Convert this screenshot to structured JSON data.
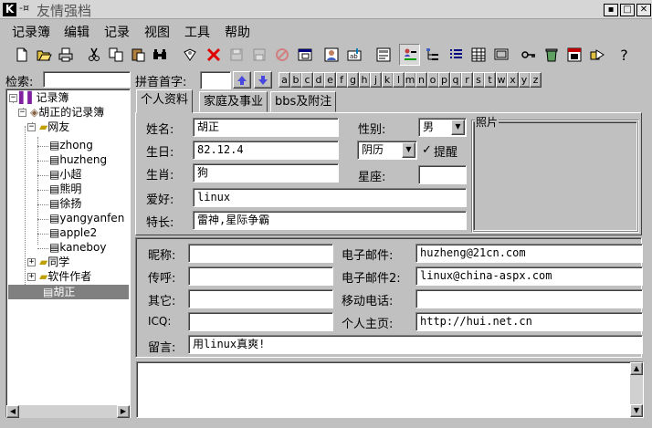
{
  "window": {
    "title": "友情强档",
    "logo_letter": "K",
    "arrow": "-¤",
    "controls": {
      "minimize": "▪",
      "maximize": "□",
      "close": "✕"
    }
  },
  "menu": [
    "记录簿",
    "编辑",
    "记录",
    "视图",
    "工具",
    "帮助"
  ],
  "toolbar": {
    "icons": [
      "new-icon",
      "open-icon",
      "print-icon",
      "cut-icon",
      "copy-icon",
      "paste-icon",
      "find-icon",
      "attach-icon",
      "delete-icon",
      "save-icon",
      "save-all-icon",
      "cancel-icon",
      "window-icon",
      "contact-card-icon",
      "edit-text-icon",
      "properties-icon",
      "contacts-view-icon",
      "tree-view-icon",
      "list-view-icon",
      "grid-view-icon",
      "layout-icon",
      "key-icon",
      "recycle-icon",
      "calendar-icon",
      "export-icon",
      "help-icon"
    ],
    "help_label": "?"
  },
  "search": {
    "label": "检索:",
    "value": ""
  },
  "tree": {
    "root": "记录簿",
    "book": "胡正的记录簿",
    "group1": "网友",
    "contacts": [
      "zhong",
      "huzheng",
      "小超",
      "熊明",
      "徐扬",
      "yangyanfen",
      "apple2",
      "kaneboy"
    ],
    "group2": "同学",
    "group3": "软件作者",
    "selected": "胡正"
  },
  "pinyin": {
    "label": "拼音首字:",
    "value": "",
    "letters": [
      "a",
      "b",
      "c",
      "d",
      "e",
      "f",
      "g",
      "h",
      "j",
      "k",
      "l",
      "m",
      "n",
      "o",
      "p",
      "q",
      "r",
      "s",
      "t",
      "w",
      "x",
      "y",
      "z"
    ]
  },
  "tabs": [
    "个人资料",
    "家庭及事业",
    "bbs及附注"
  ],
  "personal": {
    "name_label": "姓名:",
    "name": "胡正",
    "gender_label": "性别:",
    "gender": "男",
    "birthday_label": "生日:",
    "birthday": "82.12.4",
    "calendar": "阴历",
    "remind_check": "✓",
    "remind_label": "提醒",
    "zodiac_label": "生肖:",
    "zodiac": "狗",
    "star_label": "星座:",
    "star": "",
    "hobby_label": "爱好:",
    "hobby": "linux",
    "skill_label": "特长:",
    "skill": "雷神,星际争霸",
    "photo_label": "照片"
  },
  "contact": {
    "nickname_label": "昵称:",
    "nickname": "",
    "pager_label": "传呼:",
    "pager": "",
    "other_label": "其它:",
    "other": "",
    "icq_label": "ICQ:",
    "icq": "",
    "email_label": "电子邮件:",
    "email": "huzheng@21cn.com",
    "email2_label": "电子邮件2:",
    "email2": "linux@china-aspx.com",
    "mobile_label": "移动电话:",
    "mobile": "",
    "homepage_label": "个人主页:",
    "homepage": "http://hui.net.cn",
    "message_label": "留言:",
    "message": "用linux真爽!"
  },
  "notes": "",
  "colors": {
    "face": "#c0c0c0",
    "field": "#ffffff",
    "selection": "#808080",
    "arrow_blue": "#4848e0"
  }
}
